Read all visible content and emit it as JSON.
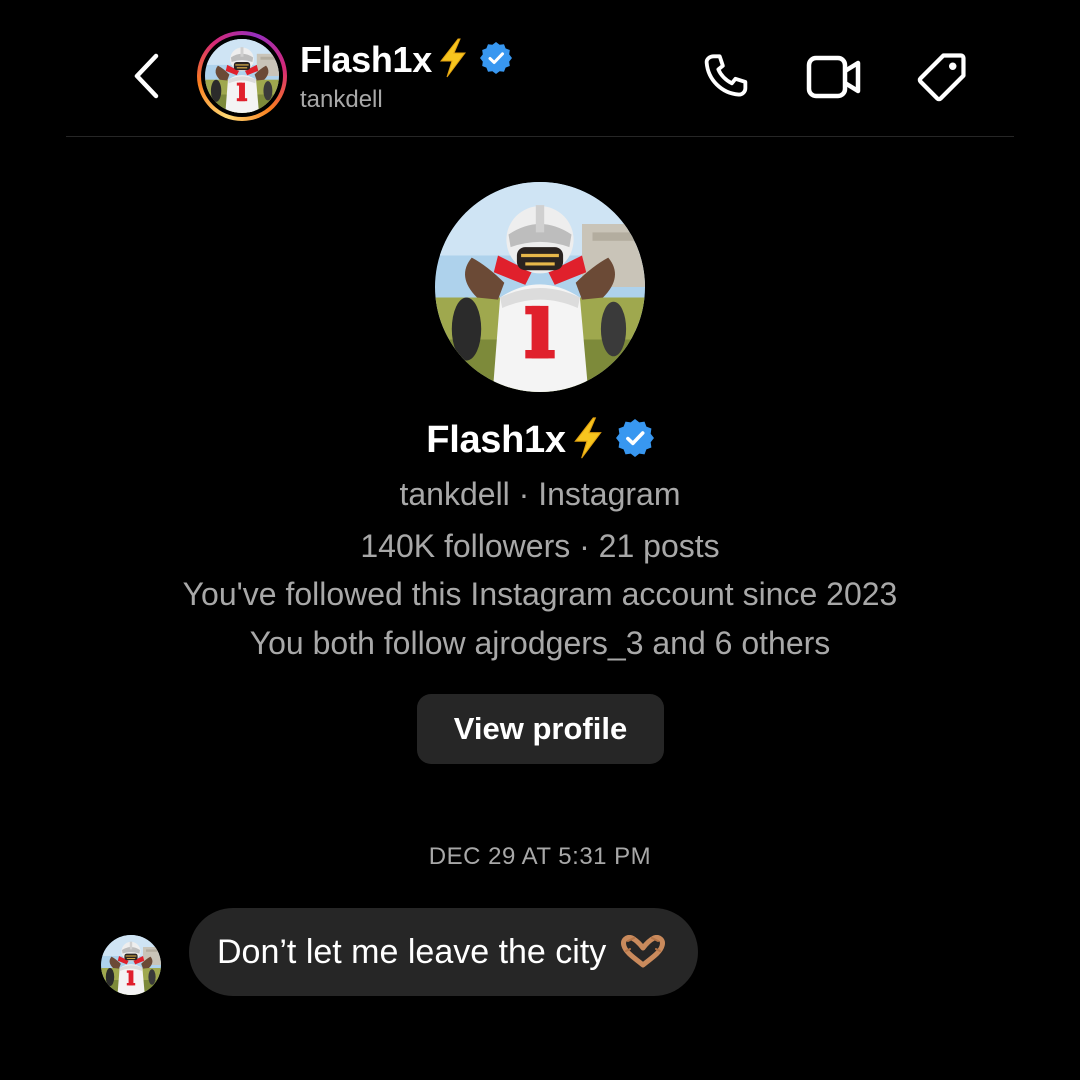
{
  "header": {
    "display_name": "Flash1x",
    "username": "tankdell",
    "actions": [
      "phone-icon",
      "video-call-icon",
      "tag-icon"
    ]
  },
  "profile": {
    "display_name": "Flash1x",
    "subtitle": "tankdell · Instagram",
    "stats": "140K followers · 21 posts",
    "follow_since": "You've followed this Instagram account since 2023",
    "mutuals": "You both follow ajrodgers_3 and 6 others",
    "view_profile_label": "View profile"
  },
  "thread": {
    "timestamp": "DEC 29 AT 5:31 PM",
    "messages": [
      {
        "text": "Don’t let me leave the city",
        "emoji": "heart-hands"
      }
    ]
  },
  "colors": {
    "background": "#000000",
    "secondary_text": "#a8a8a8",
    "bubble": "#262626",
    "verified": "#3897f0",
    "bolt": "#f7c51e",
    "jersey_red": "#e0202c"
  }
}
